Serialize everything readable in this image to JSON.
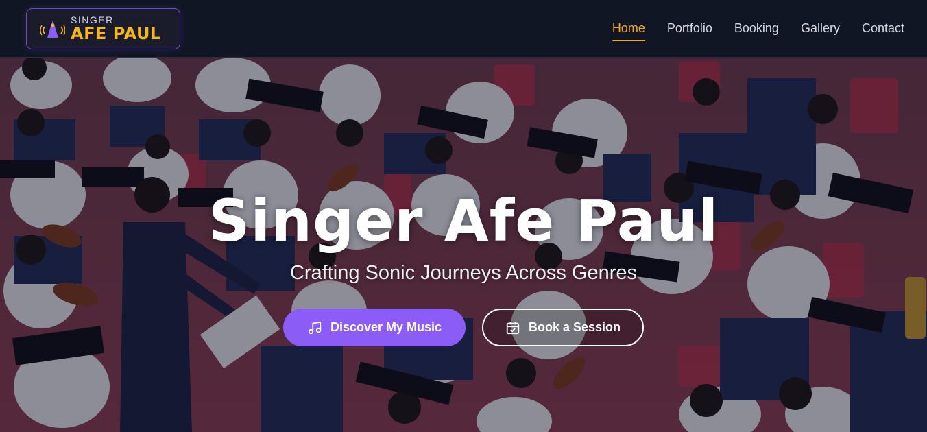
{
  "brand": {
    "top_text": "SINGER",
    "main_text": "AFE PAUL",
    "icon": "music-speaker-logo-icon",
    "accent": "#f5b71b"
  },
  "nav": {
    "items": [
      {
        "label": "Home",
        "active": true
      },
      {
        "label": "Portfolio",
        "active": false
      },
      {
        "label": "Booking",
        "active": false
      },
      {
        "label": "Gallery",
        "active": false
      },
      {
        "label": "Contact",
        "active": false
      }
    ],
    "active_color": "#f5a623"
  },
  "hero": {
    "title": "Singer Afe Paul",
    "subtitle": "Crafting Sonic Journeys Across Genres",
    "background": "orchestra-photo",
    "primary_button": {
      "label": "Discover My Music",
      "icon": "music-note-icon",
      "color": "#8b5cf6"
    },
    "secondary_button": {
      "label": "Book a Session",
      "icon": "calendar-check-icon"
    }
  }
}
